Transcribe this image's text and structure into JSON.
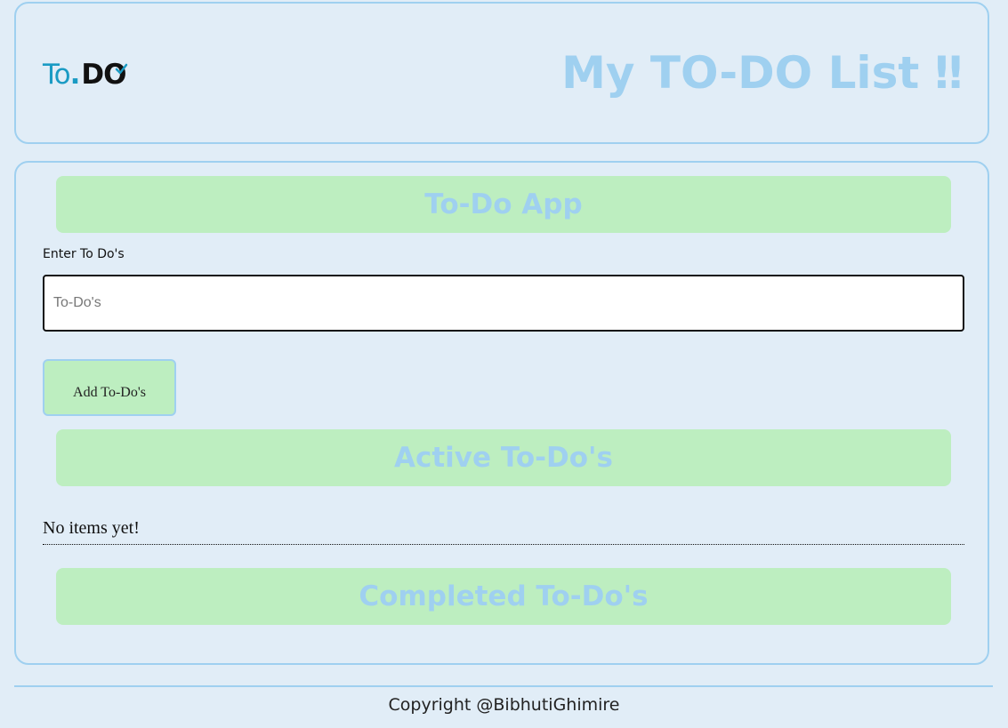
{
  "header": {
    "logo": {
      "part1": "To",
      "part2": ".",
      "part3": "DO"
    },
    "title": "My TO-DO List ‼"
  },
  "main": {
    "app_banner": "To-Do App",
    "input": {
      "label": "Enter To Do's",
      "placeholder": "To-Do's",
      "value": ""
    },
    "add_button_label": "Add To-Do's",
    "active_banner": "Active To-Do's",
    "active_empty_message": "No items yet!",
    "completed_banner": "Completed To-Do's"
  },
  "footer": {
    "copyright": "Copyright @BibhutiGhimire"
  },
  "colors": {
    "background": "#e1edf7",
    "accent_border": "#9fd0f0",
    "banner_bg": "#bdeec0",
    "logo_blue": "#1a9bc4"
  },
  "icons": {
    "logo_check": "checkmark-icon"
  }
}
